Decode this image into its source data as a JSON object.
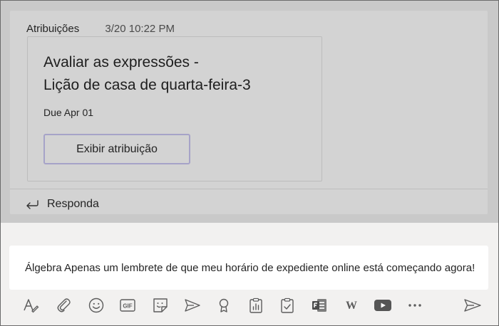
{
  "post": {
    "author": "Atribuições",
    "timestamp": "3/20 10:22 PM",
    "card": {
      "title_line1": "Avaliar as expressões -",
      "title_line2": "Lição de casa de quarta-feira-3",
      "due": "Due Apr 01",
      "button_label": "Exibir atribuição"
    },
    "reply_label": "Responda"
  },
  "compose": {
    "message": "Álgebra Apenas um lembrete de que meu horário de expediente online está começando agora!"
  },
  "toolbar": {
    "icons": [
      "format-icon",
      "attach-icon",
      "emoji-icon",
      "gif-icon",
      "sticker-icon",
      "meet-icon",
      "praise-icon",
      "insights-icon",
      "assignments-icon",
      "forms-icon",
      "wiki-icon",
      "youtube-icon",
      "more-icon",
      "send-icon"
    ],
    "wiki_glyph": "W",
    "gif_glyph": "GIF",
    "colors": {
      "icon": "#5c5c5c",
      "accent": "#6264a7"
    }
  }
}
